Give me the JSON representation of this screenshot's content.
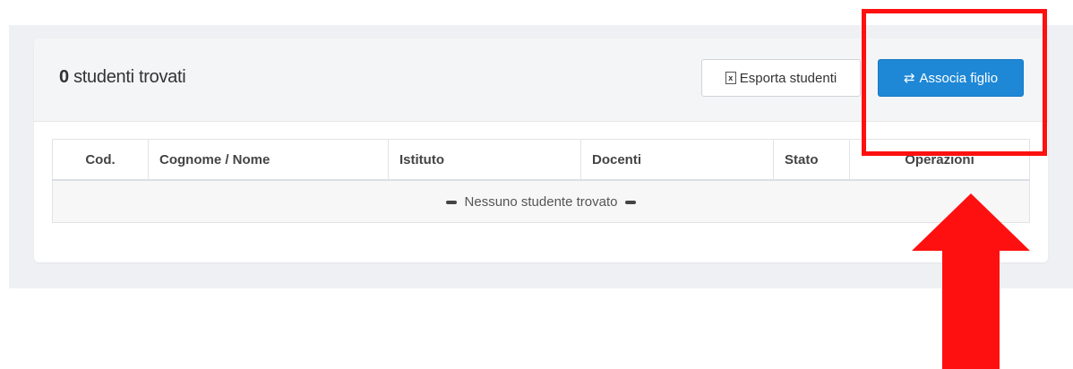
{
  "header": {
    "count": "0",
    "count_label": "studenti trovati"
  },
  "toolbar": {
    "export_label": "Esporta studenti",
    "export_icon": "excel-file-icon",
    "associate_label": "Associa figlio",
    "associate_icon": "swap-arrows-icon"
  },
  "table": {
    "columns": [
      "Cod.",
      "Cognome / Nome",
      "Istituto",
      "Docenti",
      "Stato",
      "Operazioni"
    ],
    "empty_message": "Nessuno studente trovato"
  },
  "annotations": {
    "highlight_color": "#ff1010",
    "arrow_color": "#ff1010"
  },
  "colors": {
    "primary_button": "#1e88d6",
    "page_background": "#eef0f3"
  }
}
